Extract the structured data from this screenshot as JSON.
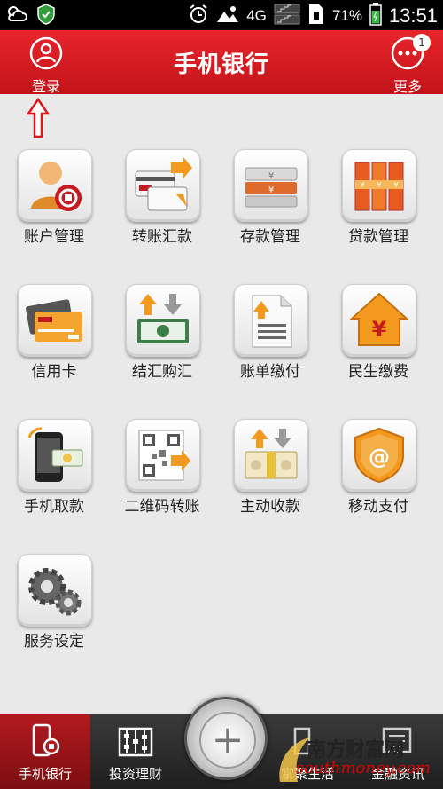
{
  "status_bar": {
    "network": "4G",
    "battery": "71%",
    "time": "13:51"
  },
  "header": {
    "title": "手机银行",
    "login_label": "登录",
    "more_label": "更多",
    "more_badge": "1"
  },
  "menu": [
    {
      "label": "账户管理",
      "icon": "account-icon"
    },
    {
      "label": "转账汇款",
      "icon": "transfer-icon"
    },
    {
      "label": "存款管理",
      "icon": "deposit-icon"
    },
    {
      "label": "贷款管理",
      "icon": "loan-icon"
    },
    {
      "label": "信用卡",
      "icon": "credit-card-icon"
    },
    {
      "label": "结汇购汇",
      "icon": "exchange-icon"
    },
    {
      "label": "账单缴付",
      "icon": "bill-icon"
    },
    {
      "label": "民生缴费",
      "icon": "home-fee-icon"
    },
    {
      "label": "手机取款",
      "icon": "phone-withdraw-icon"
    },
    {
      "label": "二维码转账",
      "icon": "qrcode-icon"
    },
    {
      "label": "主动收款",
      "icon": "collect-icon"
    },
    {
      "label": "移动支付",
      "icon": "mobile-pay-icon"
    },
    {
      "label": "服务设定",
      "icon": "settings-gear-icon"
    }
  ],
  "bottom_tabs": [
    {
      "label": "手机银行",
      "active": true
    },
    {
      "label": "投资理财",
      "active": false
    },
    {
      "label": "掌聚生活",
      "active": false
    },
    {
      "label": "金融资讯",
      "active": false
    }
  ],
  "watermark": {
    "title": "南方财富网",
    "subtitle": "southmoney.com"
  }
}
